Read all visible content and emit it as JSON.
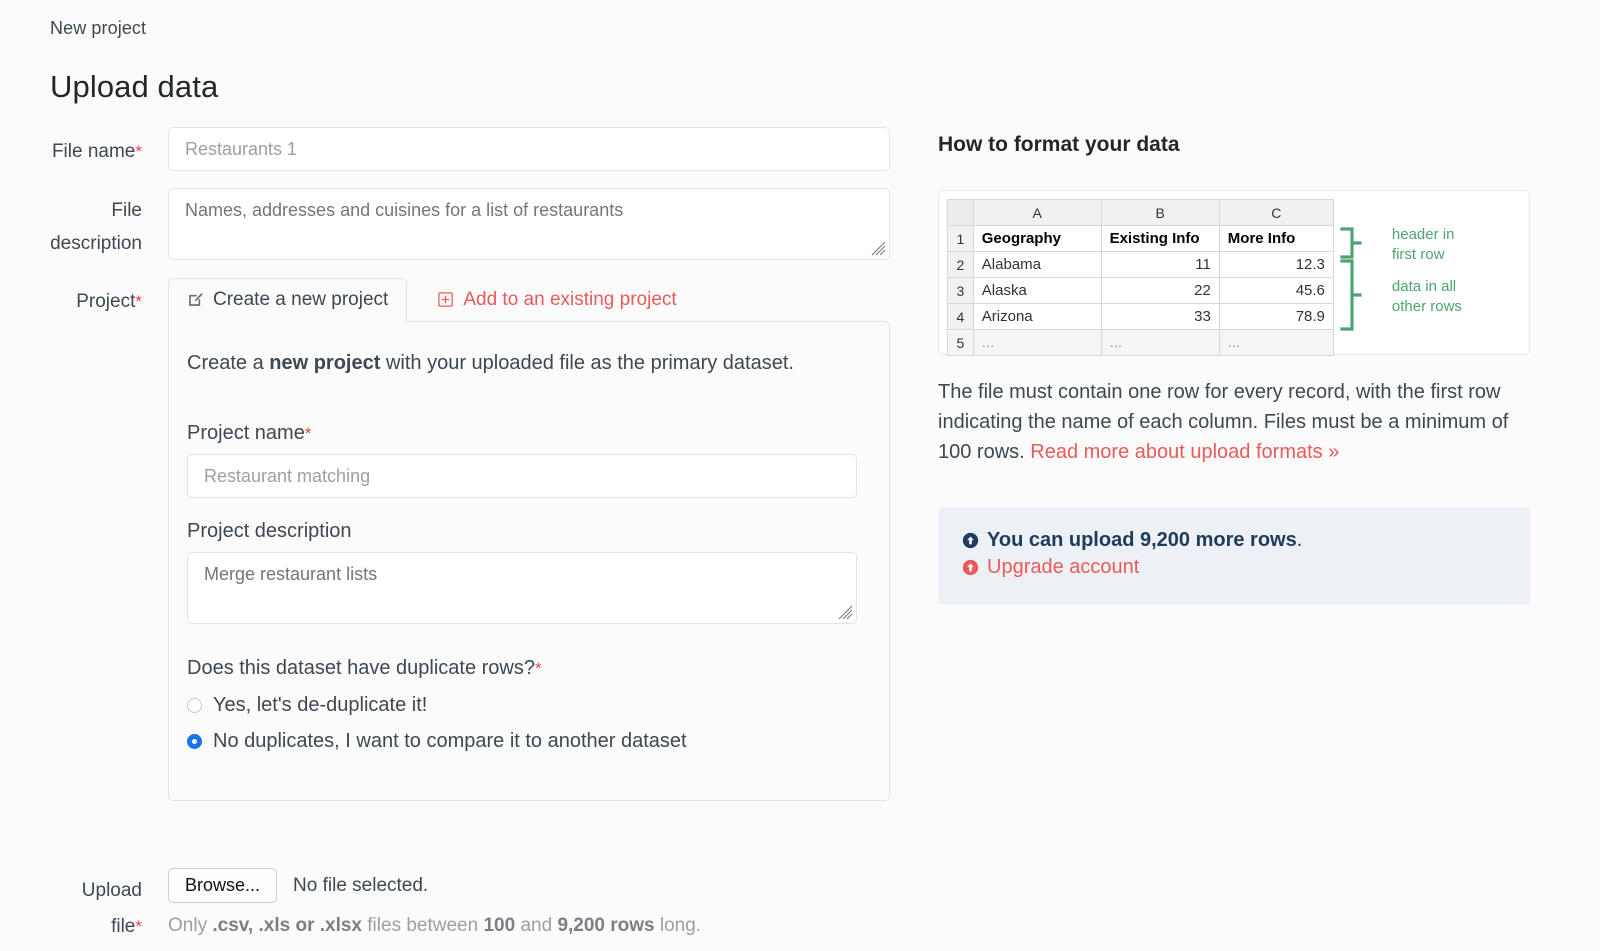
{
  "breadcrumb": "New project",
  "page_title": "Upload data",
  "form": {
    "file_name": {
      "label": "File name",
      "required_mark": "*",
      "value": "Restaurants 1"
    },
    "file_description": {
      "label_line1": "File",
      "label_line2": "description",
      "value": "Names, addresses and cuisines for a list of restaurants"
    },
    "project": {
      "label": "Project",
      "required_mark": "*"
    }
  },
  "tabs": [
    {
      "label": "Create a new project",
      "icon": "pencil-square-icon",
      "active": true
    },
    {
      "label": "Add to an existing project",
      "icon": "plus-square-icon",
      "active": false
    }
  ],
  "panel": {
    "lead_pre": "Create a ",
    "lead_bold": "new project",
    "lead_post": " with your uploaded file as the primary dataset.",
    "project_name": {
      "label": "Project name",
      "required_mark": "*",
      "value": "Restaurant matching"
    },
    "project_description": {
      "label": "Project description",
      "value": "Merge restaurant lists"
    },
    "duplicate_question": "Does this dataset have duplicate rows?",
    "duplicate_question_mark": "*",
    "options": [
      {
        "label": "Yes, let's de-duplicate it!",
        "checked": false
      },
      {
        "label": "No duplicates, I want to compare it to another dataset",
        "checked": true
      }
    ]
  },
  "upload": {
    "label_line1": "Upload",
    "label_line2": "file",
    "required_mark": "*",
    "browse_label": "Browse...",
    "no_file_text": "No file selected.",
    "hint_1": "Only ",
    "hint_formats": ".csv, .xls or .xlsx",
    "hint_2": " files between ",
    "hint_min": "100",
    "hint_3": " and ",
    "hint_max": "9,200 rows",
    "hint_4": " long."
  },
  "sidebar": {
    "title": "How to format your data",
    "spreadsheet": {
      "col_headers": [
        "A",
        "B",
        "C"
      ],
      "rows": [
        {
          "n": "1",
          "cells": [
            "Geography",
            "Existing Info",
            "More Info"
          ],
          "header": true
        },
        {
          "n": "2",
          "cells": [
            "Alabama",
            "11",
            "12.3"
          ],
          "header": false
        },
        {
          "n": "3",
          "cells": [
            "Alaska",
            "22",
            "45.6"
          ],
          "header": false
        },
        {
          "n": "4",
          "cells": [
            "Arizona",
            "33",
            "78.9"
          ],
          "header": false
        },
        {
          "n": "5",
          "cells": [
            "...",
            "...",
            "..."
          ],
          "header": false
        }
      ],
      "annotation_header_l1": "header in",
      "annotation_header_l2": "first row",
      "annotation_data_l1": "data in all",
      "annotation_data_l2": "other rows"
    },
    "paragraph_1": "The file must contain one row for every record, with the first row indicating the name of each column. Files must be a minimum of 100 rows. ",
    "paragraph_link": "Read more about upload formats »",
    "quota": {
      "line1_text": "You can upload 9,200 more rows",
      "line1_suffix": ".",
      "line2_text": "Upgrade account",
      "icon": "arrow-up-circle-icon"
    }
  },
  "colors": {
    "accent_red": "#ea5a5a",
    "required_red": "#e8453c",
    "radio_blue": "#1a73e8",
    "annotation_green": "#4fa373",
    "quota_bg": "#edf1f5",
    "quota_text": "#1f3b5c"
  }
}
